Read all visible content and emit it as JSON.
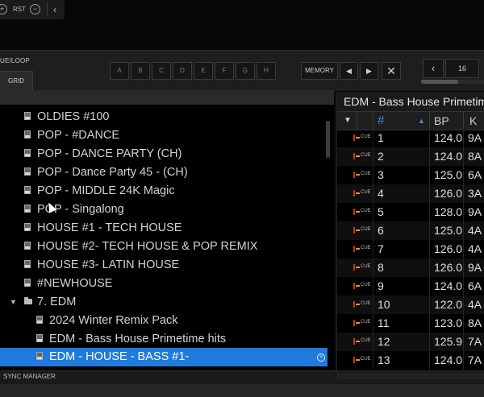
{
  "top": {
    "rst_label": "RST"
  },
  "cue_panel": {
    "mode_label": "UE/LOOP",
    "grid_tab": "GRID",
    "pads": [
      "A",
      "B",
      "C",
      "D",
      "E",
      "F",
      "G",
      "H"
    ],
    "memory_label": "MEMORY",
    "zoom_value": "16"
  },
  "tree": {
    "items": [
      {
        "label": "OLDIES #100",
        "type": "playlist"
      },
      {
        "label": "POP - #DANCE",
        "type": "playlist"
      },
      {
        "label": "POP - DANCE PARTY (CH)",
        "type": "playlist"
      },
      {
        "label": "POP - Dance Party 45 - (CH)",
        "type": "playlist"
      },
      {
        "label": "POP - MIDDLE  24K Magic",
        "type": "playlist"
      },
      {
        "label": "POP - Singalong",
        "type": "playlist"
      },
      {
        "label": "HOUSE #1  - TECH HOUSE",
        "type": "playlist"
      },
      {
        "label": "HOUSE #2- TECH HOUSE & POP REMIX",
        "type": "playlist"
      },
      {
        "label": "HOUSE #3- LATIN HOUSE",
        "type": "playlist"
      },
      {
        "label": "#NEWHOUSE",
        "type": "playlist"
      },
      {
        "label": "7. EDM",
        "type": "folder"
      },
      {
        "label": "2024 Winter Remix Pack",
        "type": "playlist"
      },
      {
        "label": "EDM - Bass House Primetime hits",
        "type": "playlist"
      },
      {
        "label": "EDM - HOUSE - BASS #1-",
        "type": "playlist",
        "selected": true
      }
    ]
  },
  "list": {
    "title": "EDM - Bass House Primetime hits",
    "columns": {
      "num": "#",
      "bpm": "BP",
      "key": "K"
    },
    "cue_label": "CUE",
    "rows": [
      {
        "num": "1",
        "bpm": "124.0",
        "key": "9A"
      },
      {
        "num": "2",
        "bpm": "124.0",
        "key": "8A"
      },
      {
        "num": "3",
        "bpm": "125.0",
        "key": "6A"
      },
      {
        "num": "4",
        "bpm": "126.0",
        "key": "3A"
      },
      {
        "num": "5",
        "bpm": "128.0",
        "key": "9A"
      },
      {
        "num": "6",
        "bpm": "125.0",
        "key": "4A"
      },
      {
        "num": "7",
        "bpm": "126.0",
        "key": "4A"
      },
      {
        "num": "8",
        "bpm": "126.0",
        "key": "9A"
      },
      {
        "num": "9",
        "bpm": "124.0",
        "key": "6A"
      },
      {
        "num": "10",
        "bpm": "122.0",
        "key": "4A"
      },
      {
        "num": "11",
        "bpm": "123.0",
        "key": "8A"
      },
      {
        "num": "12",
        "bpm": "125.9",
        "key": "7A"
      },
      {
        "num": "13",
        "bpm": "124.0",
        "key": "7A"
      }
    ]
  },
  "bottom": {
    "sync_manager": "SYNC MANAGER"
  },
  "colors": {
    "selection": "#1f7bdc",
    "sort_accent": "#3b8ee8"
  }
}
